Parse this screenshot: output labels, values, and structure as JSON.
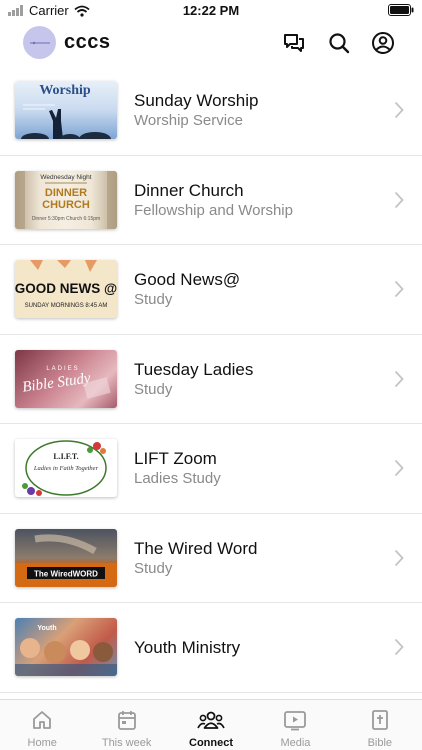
{
  "status_bar": {
    "carrier": "Carrier",
    "time": "12:22 PM"
  },
  "header": {
    "app_title": "cccs"
  },
  "items": [
    {
      "title": "Sunday Worship",
      "subtitle": "Worship Service",
      "thumb_text": "Worship"
    },
    {
      "title": "Dinner Church",
      "subtitle": "Fellowship and Worship",
      "thumb_text": "DINNER CHURCH",
      "thumb_top": "Wednesday Night",
      "thumb_small": "Dinner 5:30pm Church 6:15pm"
    },
    {
      "title": "Good News@",
      "subtitle": "Study",
      "thumb_text": "GOOD NEWS @",
      "thumb_small": "SUNDAY MORNINGS 8:45 AM"
    },
    {
      "title": "Tuesday Ladies",
      "subtitle": "Study",
      "thumb_text": "Bible Study",
      "thumb_top": "LADIES"
    },
    {
      "title": "LIFT Zoom",
      "subtitle": "Ladies Study",
      "thumb_text": "L.I.F.T.",
      "thumb_small": "Ladies in Faith Together"
    },
    {
      "title": "The Wired  Word",
      "subtitle": "Study",
      "thumb_text": "The WiredWORD"
    },
    {
      "title": "Youth Ministry",
      "subtitle": "",
      "thumb_text": "Youth"
    }
  ],
  "tabs": [
    {
      "label": "Home",
      "icon": "home-icon"
    },
    {
      "label": "This week",
      "icon": "calendar-icon"
    },
    {
      "label": "Connect",
      "icon": "people-icon"
    },
    {
      "label": "Media",
      "icon": "play-icon"
    },
    {
      "label": "Bible",
      "icon": "bible-icon"
    }
  ],
  "colors": {
    "accent": "#111111",
    "inactive": "#9a9a9a",
    "avatar": "#c6c6ec",
    "separator": "#e6e6e6"
  }
}
